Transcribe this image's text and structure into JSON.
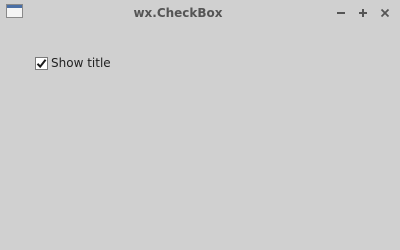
{
  "window": {
    "title": "wx.CheckBox",
    "app_icon": "window-icon",
    "controls": {
      "minimize_icon": "minimize-icon",
      "maximize_icon": "maximize-icon",
      "close_icon": "close-icon"
    },
    "background_color": "#d0d0d0"
  },
  "content": {
    "checkbox": {
      "label": "Show title",
      "checked": true,
      "check_icon": "checkmark-icon"
    }
  }
}
